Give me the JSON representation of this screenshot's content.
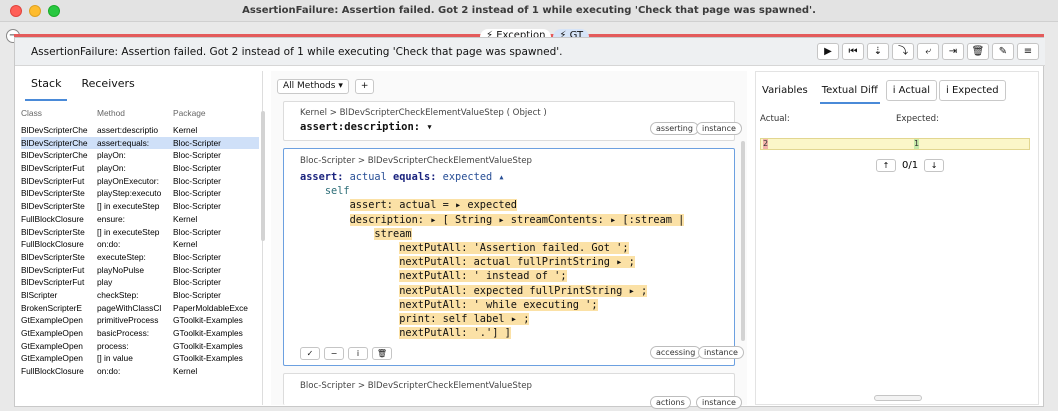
{
  "window": {
    "title": "AssertionFailure: Assertion failed. Got 2 instead of 1 while executing 'Check that page was spawned'."
  },
  "top_tabs": [
    {
      "label": "⚡ Exception"
    },
    {
      "label": "⚡ GT"
    }
  ],
  "header": {
    "text": "AssertionFailure: Assertion failed. Got 2 instead of 1 while executing 'Check that page was spawned'.",
    "tools": [
      "▶",
      "⏮",
      "⇣",
      "⤵",
      "⤶",
      "⇥",
      "🗑",
      "✎",
      "≡"
    ]
  },
  "left": {
    "tabs": [
      "Stack",
      "Receivers"
    ],
    "columns": [
      "Class",
      "Method",
      "Package"
    ],
    "rows": [
      [
        "BlDevScripterChe",
        "assert:descriptio",
        "Kernel"
      ],
      [
        "BlDevScripterChe",
        "assert:equals:",
        "Bloc-Scripter"
      ],
      [
        "BlDevScripterChe",
        "playOn:",
        "Bloc-Scripter"
      ],
      [
        "BlDevScripterFut",
        "playOn:",
        "Bloc-Scripter"
      ],
      [
        "BlDevScripterFut",
        "playOnExecutor:",
        "Bloc-Scripter"
      ],
      [
        "BlDevScripterSte",
        "playStep:executo",
        "Bloc-Scripter"
      ],
      [
        "BlDevScripterSte",
        "[] in executeStep",
        "Bloc-Scripter"
      ],
      [
        "FullBlockClosure",
        "ensure:",
        "Kernel"
      ],
      [
        "BlDevScripterSte",
        "[] in executeStep",
        "Bloc-Scripter"
      ],
      [
        "FullBlockClosure",
        "on:do:",
        "Kernel"
      ],
      [
        "BlDevScripterSte",
        "executeStep:",
        "Bloc-Scripter"
      ],
      [
        "BlDevScripterFut",
        "playNoPulse",
        "Bloc-Scripter"
      ],
      [
        "BlDevScripterFut",
        "play",
        "Bloc-Scripter"
      ],
      [
        "BlScripter",
        "checkStep:",
        "Bloc-Scripter"
      ],
      [
        "BrokenScripterE",
        "pageWithClassCl",
        "PaperMoldableExce"
      ],
      [
        "GtExampleOpen",
        "primitiveProcess",
        "GToolkit-Examples"
      ],
      [
        "GtExampleOpen",
        "basicProcess:",
        "GToolkit-Examples"
      ],
      [
        "GtExampleOpen",
        "process:",
        "GToolkit-Examples"
      ],
      [
        "GtExampleOpen",
        "[] in value",
        "GToolkit-Examples"
      ],
      [
        "FullBlockClosure",
        "on:do:",
        "Kernel"
      ]
    ],
    "selected_index": 1
  },
  "middle": {
    "all_methods_label": "All Methods ▾",
    "plus_label": "+",
    "card1": {
      "crumb": "Kernel  >  BlDevScripterCheckElementValueStep ( Object )",
      "selector": "assert:description: ▾",
      "tags": [
        "asserting",
        "instance"
      ]
    },
    "card2": {
      "crumb": "Bloc-Scripter  >  BlDevScripterCheckElementValueStep",
      "tags": [
        "accessing",
        "instance"
      ],
      "buttons": [
        "✓",
        "−",
        "i",
        "🗑"
      ]
    },
    "card3": {
      "crumb": "Bloc-Scripter  >  BlDevScripterCheckElementValueStep",
      "tags": [
        "actions",
        "instance"
      ]
    },
    "code_lines": [
      {
        "parts": [
          {
            "t": "assert: ",
            "c": "kw"
          },
          {
            "t": "actual ",
            "c": "blue"
          },
          {
            "t": "equals: ",
            "c": "kw"
          },
          {
            "t": "expected ▴",
            "c": "blue"
          }
        ]
      },
      {
        "parts": [
          {
            "t": "    ",
            "c": ""
          },
          {
            "t": "self",
            "c": "tealkw"
          }
        ]
      },
      {
        "parts": [
          {
            "t": "        ",
            "c": ""
          },
          {
            "t": "assert: actual = ▸ expected",
            "c": "hl"
          }
        ]
      },
      {
        "parts": [
          {
            "t": "        ",
            "c": ""
          },
          {
            "t": "description: ▸ [ String ▸ streamContents: ▸ [:stream |",
            "c": "hl"
          }
        ]
      },
      {
        "parts": [
          {
            "t": "            ",
            "c": ""
          },
          {
            "t": "stream",
            "c": "hl"
          }
        ]
      },
      {
        "parts": [
          {
            "t": "                ",
            "c": ""
          },
          {
            "t": "nextPutAll: 'Assertion failed. Got ';",
            "c": "hl"
          }
        ]
      },
      {
        "parts": [
          {
            "t": "                ",
            "c": ""
          },
          {
            "t": "nextPutAll: actual fullPrintString ▸ ;",
            "c": "hl"
          }
        ]
      },
      {
        "parts": [
          {
            "t": "                ",
            "c": ""
          },
          {
            "t": "nextPutAll: ' instead of ';",
            "c": "hl"
          }
        ]
      },
      {
        "parts": [
          {
            "t": "                ",
            "c": ""
          },
          {
            "t": "nextPutAll: expected fullPrintString ▸ ;",
            "c": "hl"
          }
        ]
      },
      {
        "parts": [
          {
            "t": "                ",
            "c": ""
          },
          {
            "t": "nextPutAll: ' while executing ';",
            "c": "hl"
          }
        ]
      },
      {
        "parts": [
          {
            "t": "                ",
            "c": ""
          },
          {
            "t": "print: self label ▸ ;",
            "c": "hl"
          }
        ]
      },
      {
        "parts": [
          {
            "t": "                ",
            "c": ""
          },
          {
            "t": "nextPutAll: '.'] ]",
            "c": "hl"
          }
        ]
      }
    ]
  },
  "right": {
    "tabs": [
      "Variables",
      "Textual Diff",
      "i Actual",
      "i Expected"
    ],
    "actual_label": "Actual:",
    "expected_label": "Expected:",
    "actual_value": "2",
    "expected_value": "1",
    "diff_counter": "0/1",
    "up_label": "↑",
    "down_label": "↓"
  },
  "colors": {
    "error_line": "#e45b5b",
    "selection": "#cfe0f8",
    "highlight": "#fbe1a6"
  }
}
